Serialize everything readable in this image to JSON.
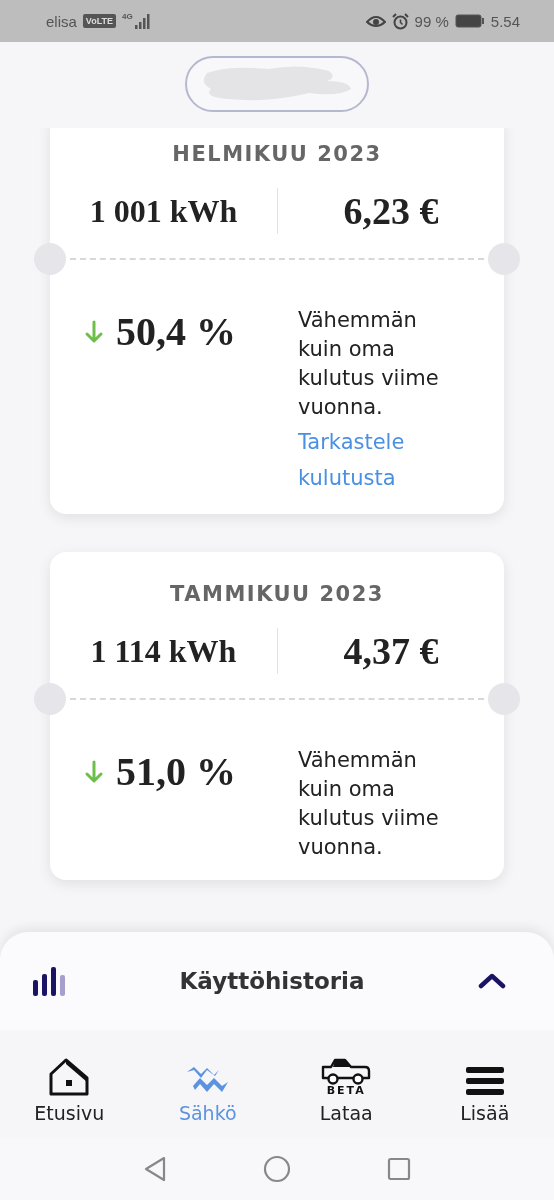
{
  "status_bar": {
    "carrier": "elisa",
    "volte": "VoLTE",
    "network": "4G",
    "battery": "99 %",
    "time": "5.54"
  },
  "months": [
    {
      "month": "HELMIKUU 2023",
      "energy": "1 001 kWh",
      "cost": "6,23 €",
      "kind": "down",
      "change": "50,4 %",
      "description": "Vähemmän kuin oma kulutus viime vuonna.",
      "link": "Tarkastele kulutusta"
    },
    {
      "month": "TAMMIKUU 2023",
      "energy": "1 114 kWh",
      "cost": "4,37 €",
      "kind": "down",
      "change": "51,0 %",
      "description": "Vähemmän kuin oma kulutus viime vuonna."
    }
  ],
  "history_sheet": {
    "title": "Käyttöhistoria",
    "expanded": false
  },
  "nav": [
    {
      "kind": "home",
      "label": "Etusivu",
      "selected": false
    },
    {
      "kind": "electricity",
      "label": "Sähkö",
      "selected": true
    },
    {
      "kind": "car",
      "label": "Lataa",
      "badge": "BETA",
      "selected": false
    },
    {
      "kind": "menu",
      "label": "Lisää",
      "selected": false
    }
  ]
}
